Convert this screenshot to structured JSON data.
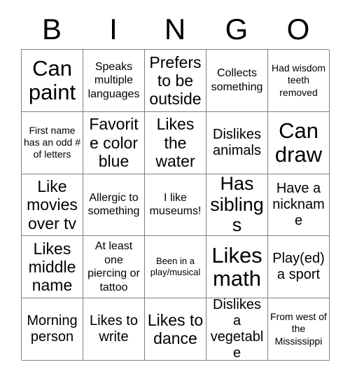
{
  "card": {
    "title": "BINGO Card",
    "background_color": "#ffffff",
    "grid_line_color": "#808080",
    "text_color": "#000000",
    "header_letters": [
      "B",
      "I",
      "N",
      "G",
      "O"
    ],
    "columns": 5,
    "rows": 5,
    "cells": [
      [
        {
          "text": "Can paint",
          "size": "xxl"
        },
        {
          "text": "Speaks multiple languages",
          "size": "sm"
        },
        {
          "text": "Prefers to be outside",
          "size": "lg"
        },
        {
          "text": "Collects something",
          "size": "sm"
        },
        {
          "text": "Had wisdom teeth removed",
          "size": "xs"
        }
      ],
      [
        {
          "text": "First name has an odd # of letters",
          "size": "xs"
        },
        {
          "text": "Favorite color blue",
          "size": "lg"
        },
        {
          "text": "Likes the water",
          "size": "lg"
        },
        {
          "text": "Dislikes animals",
          "size": "md"
        },
        {
          "text": "Can draw",
          "size": "xxl"
        }
      ],
      [
        {
          "text": "Like movies over tv",
          "size": "lg"
        },
        {
          "text": "Allergic to something",
          "size": "sm"
        },
        {
          "text": "I like museums!",
          "size": "sm"
        },
        {
          "text": "Has siblings",
          "size": "xl"
        },
        {
          "text": "Have a nickname",
          "size": "md"
        }
      ],
      [
        {
          "text": "Likes middle name",
          "size": "lg"
        },
        {
          "text": "At least one piercing or tattoo",
          "size": "sm"
        },
        {
          "text": "Been in a play/musical",
          "size": "xxs"
        },
        {
          "text": "Likes math",
          "size": "xxl"
        },
        {
          "text": "Play(ed) a sport",
          "size": "md"
        }
      ],
      [
        {
          "text": "Morning person",
          "size": "md"
        },
        {
          "text": "Likes to write",
          "size": "md"
        },
        {
          "text": "Likes to dance",
          "size": "lg"
        },
        {
          "text": "Dislikes a vegetable",
          "size": "md"
        },
        {
          "text": "From west of the Mississippi",
          "size": "xs"
        }
      ]
    ]
  }
}
